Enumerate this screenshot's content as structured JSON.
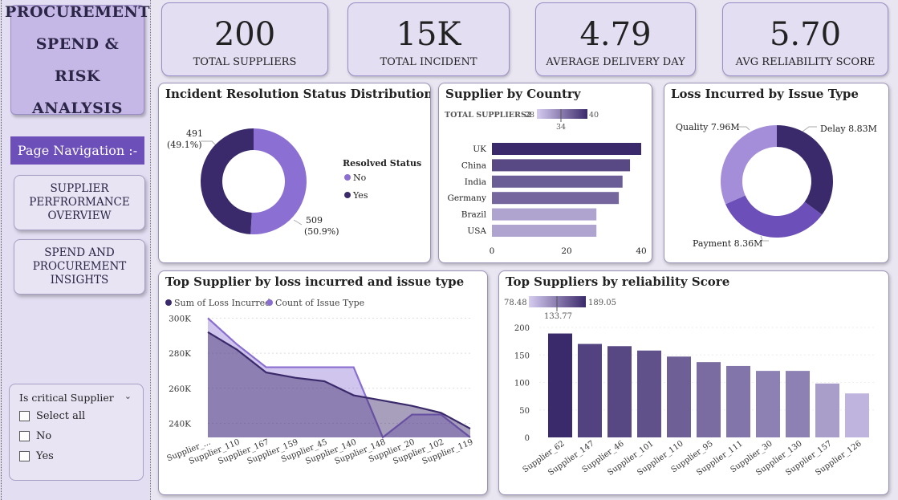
{
  "sidebar": {
    "title_lines": [
      "PROCUREMENT",
      "SPEND &",
      "RISK ANALYSIS"
    ],
    "page_nav_label": "Page Navigation :-",
    "nav_buttons": [
      {
        "lines": [
          "SUPPLIER",
          "PERFRORMANCE",
          "OVERVIEW"
        ]
      },
      {
        "lines": [
          "SPEND AND",
          "PROCUREMENT",
          "INSIGHTS"
        ]
      }
    ],
    "slicer": {
      "title": "Is critical Supplier",
      "options": [
        "Select all",
        "No",
        "Yes"
      ]
    }
  },
  "kpis": [
    {
      "value": "200",
      "label": "TOTAL SUPPLIERS"
    },
    {
      "value": "15K",
      "label": "TOTAL INCIDENT"
    },
    {
      "value": "4.79",
      "label": "AVERAGE DELIVERY DAY"
    },
    {
      "value": "5.70",
      "label": "AVG RELIABILITY SCORE"
    }
  ],
  "colors": {
    "dark_purple": "#3b2a6b",
    "mid_purple": "#8a6fd0",
    "light_purple": "#c9bbec",
    "nav_purple": "#6c4fb8"
  },
  "chart_data": [
    {
      "type": "pie",
      "title": "Incident Resolution Status Distribution",
      "legend_title": "Resolved Status",
      "slices": [
        {
          "label": "No",
          "value": 509,
          "pct_label": "(50.9%)",
          "color": "#8c6fd2"
        },
        {
          "label": "Yes",
          "value": 491,
          "pct_label": "(49.1%)",
          "color": "#3b2a6b"
        }
      ]
    },
    {
      "type": "bar",
      "title": "Supplier by Country",
      "legend_title": "TOTAL SUPPLIERS2",
      "gradient": {
        "min": 28,
        "max": 40,
        "mid": 34
      },
      "categories": [
        "UK",
        "China",
        "India",
        "Germany",
        "Brazil",
        "USA"
      ],
      "values": [
        40,
        37,
        35,
        34,
        28,
        28
      ],
      "xticks": [
        0,
        20,
        40
      ],
      "xlim": [
        0,
        40
      ]
    },
    {
      "type": "pie",
      "title": "Loss Incurred by Issue Type",
      "slices": [
        {
          "label": "Delay 8.83M",
          "value": 8.83,
          "color": "#3b2a6b"
        },
        {
          "label": "Payment 8.36M",
          "value": 8.36,
          "color": "#6c4fb8"
        },
        {
          "label": "Quality 7.96M",
          "value": 7.96,
          "color": "#a48ed9"
        }
      ]
    },
    {
      "type": "area",
      "title": "Top Supplier by loss incurred and issue type",
      "categories": [
        "Supplier_...",
        "Supplier_110",
        "Supplier_167",
        "Supplier_159",
        "Supplier_45",
        "Supplier_140",
        "Supplier_148",
        "Supplier_20",
        "Supplier_102",
        "Supplier_119"
      ],
      "series": [
        {
          "name": "Sum of Loss Incurred",
          "values": [
            292000,
            282000,
            269000,
            266000,
            264000,
            256000,
            253000,
            250000,
            246000,
            237000
          ],
          "color": "#3b2a6b"
        },
        {
          "name": "Count of Issue Type",
          "values": [
            300000,
            285000,
            272000,
            272000,
            272000,
            272000,
            232000,
            245000,
            245000,
            232000
          ],
          "color": "#8a6fd0"
        }
      ],
      "yticks": [
        "300K",
        "280K",
        "260K",
        "240K"
      ],
      "ylim": [
        232000,
        302000
      ]
    },
    {
      "type": "bar",
      "title": "Top Suppliers by reliability Score",
      "gradient": {
        "min": "78.48",
        "max": "189.05",
        "mid": "133.77"
      },
      "categories": [
        "Supplier_62",
        "Supplier_147",
        "Supplier_46",
        "Supplier_101",
        "Supplier_110",
        "Supplier_95",
        "Supplier_111",
        "Supplier_30",
        "Supplier_130",
        "Supplier_157",
        "Supplier_126"
      ],
      "values": [
        189,
        170,
        166,
        158,
        147,
        137,
        130,
        121,
        121,
        98,
        80
      ],
      "yticks": [
        0,
        50,
        100,
        150,
        200
      ],
      "ylim": [
        0,
        200
      ]
    }
  ]
}
